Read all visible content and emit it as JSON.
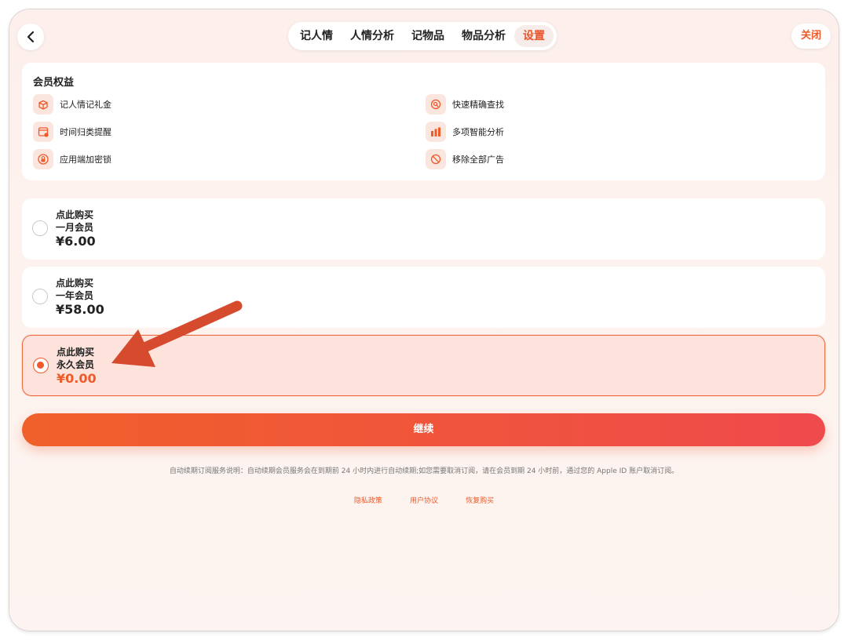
{
  "header": {
    "tabs": [
      {
        "label": "记人情"
      },
      {
        "label": "人情分析"
      },
      {
        "label": "记物品"
      },
      {
        "label": "物品分析"
      },
      {
        "label": "设置"
      }
    ],
    "active_tab": "设置",
    "close_label": "关闭"
  },
  "benefits": {
    "title": "会员权益",
    "items": [
      {
        "label": "记人情记礼金",
        "icon": "gift-box-icon"
      },
      {
        "label": "快速精确查找",
        "icon": "search-icon"
      },
      {
        "label": "时间归类提醒",
        "icon": "calendar-icon"
      },
      {
        "label": "多项智能分析",
        "icon": "bar-chart-icon"
      },
      {
        "label": "应用端加密锁",
        "icon": "lock-icon"
      },
      {
        "label": "移除全部广告",
        "icon": "no-ads-icon"
      }
    ]
  },
  "plans": [
    {
      "line1": "点此购买",
      "line2": "一月会员",
      "price": "¥6.00",
      "selected": false
    },
    {
      "line1": "点此购买",
      "line2": "一年会员",
      "price": "¥58.00",
      "selected": false
    },
    {
      "line1": "点此购买",
      "line2": "永久会员",
      "price": "¥0.00",
      "selected": true
    }
  ],
  "continue_label": "继续",
  "notice": "自动续期订阅服务说明：自动续期会员服务会在到期前 24 小时内进行自动续期;如您需要取消订阅，请在会员到期 24 小时前，通过您的 Apple ID 账户取消订阅。",
  "links": {
    "privacy": "隐私政策",
    "agreement": "用户协议",
    "restore": "恢复购买"
  },
  "colors": {
    "accent": "#ee5a2a",
    "selected_bg": "#fde3dc",
    "annotation_arrow": "#d64a2e"
  }
}
